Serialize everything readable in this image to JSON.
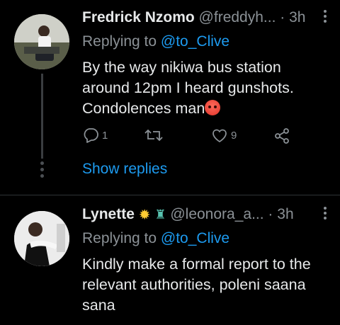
{
  "tweets": [
    {
      "name": "Fredrick Nzomo",
      "handle": "@freddyh...",
      "separator": "·",
      "time": "3h",
      "reply_prefix": "Replying to ",
      "reply_to": "@to_Clive",
      "body_lines": [
        "By the way nikiwa bus station",
        "around 12pm I heard gunshots.",
        "Condolences man"
      ],
      "body_emoji": "angry-face-emoji",
      "reply_count": "1",
      "retweet_count": "",
      "like_count": "9",
      "show_replies": "Show replies",
      "more_icon": "more-vertical-icon"
    },
    {
      "name": "Lynette",
      "name_emojis": [
        "sun-emoji",
        "statue-of-liberty-emoji"
      ],
      "handle": "@leonora_a...",
      "separator": "·",
      "time": "3h",
      "reply_prefix": "Replying to ",
      "reply_to": "@to_Clive",
      "body_lines": [
        "Kindly make a formal report to the",
        "relevant authorities, poleni saana",
        "sana"
      ],
      "more_icon": "more-vertical-icon"
    }
  ],
  "colors": {
    "background": "#000000",
    "text": "#e7e9ea",
    "secondary": "#8b9196",
    "accent": "#1d9bf0",
    "divider": "#2f3336"
  },
  "icons": [
    "reply-icon",
    "retweet-icon",
    "like-icon",
    "share-icon"
  ]
}
